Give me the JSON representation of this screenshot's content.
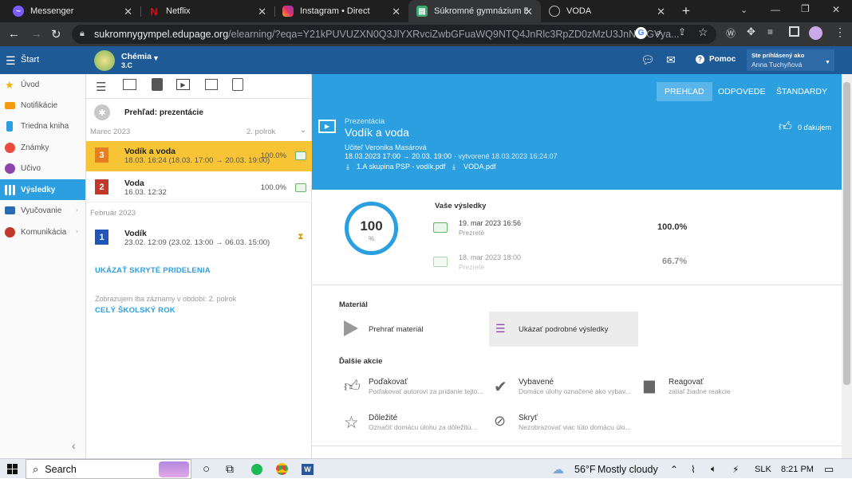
{
  "browser": {
    "tabs": [
      {
        "title": "Messenger",
        "icon": "messenger-icon",
        "color": "#7b5cff"
      },
      {
        "title": "Netflix",
        "icon": "netflix-icon",
        "color": "#e50914"
      },
      {
        "title": "Instagram • Direct",
        "icon": "instagram-icon",
        "color": "#e1306c"
      },
      {
        "title": "Súkromné gymnázium Ba",
        "icon": "edupage-icon",
        "color": "#3aa76d"
      },
      {
        "title": "VODA",
        "icon": "globe-icon",
        "color": "#bbbbbb"
      }
    ],
    "url_host": "sukromnygympel.edupage.org",
    "url_path": "/elearning/?eqa=Y21kPUVUZXN0Q3JlYXRvciZwbGFuaWQ9NTQ4JnRlc3RpZD0zMzU3JnN1cGVya..."
  },
  "topbar": {
    "menu_label": "Štart",
    "class_title": "Chémia",
    "class_sub": "3.C",
    "help_label": "Pomoc",
    "user_caption": "Ste prihlásený ako",
    "user_name": "Anna Tuchyňová"
  },
  "sidebar": {
    "items": [
      {
        "label": "Úvod",
        "icon": "star-icon",
        "color": "#f4b400"
      },
      {
        "label": "Notifikácie",
        "icon": "envelope-icon",
        "color": "#f39c12"
      },
      {
        "label": "Triedna kniha",
        "icon": "book-icon",
        "color": "#2b9fe0"
      },
      {
        "label": "Známky",
        "icon": "grades-icon",
        "color": "#e74c3c"
      },
      {
        "label": "Učivo",
        "icon": "learning-icon",
        "color": "#8e44ad"
      },
      {
        "label": "Výsledky",
        "icon": "results-icon",
        "color": "#ffffff"
      },
      {
        "label": "Vyučovanie",
        "icon": "teaching-icon",
        "color": "#2b6cb0"
      },
      {
        "label": "Komunikácia",
        "icon": "chat-icon",
        "color": "#c0392b"
      }
    ]
  },
  "list": {
    "header": "Prehľad: prezentácie",
    "group1_month": "Marec 2023",
    "group1_term": "2. polrok",
    "group2_month": "Február 2023",
    "rows": [
      {
        "num": "3",
        "title": "Vodík a voda",
        "sub": "18.03. 16:24 (18.03. 17:00 → 20.03. 19:00)",
        "pct": "100.0%",
        "color": "#e67e22"
      },
      {
        "num": "2",
        "title": "Voda",
        "sub": "16.03. 12:32",
        "pct": "100.0%",
        "color": "#c0392b"
      },
      {
        "num": "1",
        "title": "Vodík",
        "sub": "23.02. 12:09 (23.02. 13:00 → 06.03. 15:00)",
        "pct": "",
        "color": "#2255b8"
      }
    ],
    "show_hidden": "UKÁZAŤ SKRYTÉ PRIDELENIA",
    "period_note": "Zobrazujem iba záznamy v období: 2. polrok",
    "whole_year": "CELÝ ŠKOLSKÝ ROK"
  },
  "main": {
    "tabs": [
      "PREHĽAD",
      "ODPOVEDE",
      "ŠTANDARDY"
    ],
    "kind": "Prezentácia",
    "title": "Vodík a voda",
    "teacher": "Učiteľ Veronika Masárová",
    "dates": "18.03.2023 17:00 → 20.03. 19:00",
    "created": "· vytvorené 18.03.2023 16:24:07",
    "file1": "1.A skupina PSP - vodík.pdf",
    "file2": "VODA.pdf",
    "thanks": "0 ďakujem",
    "score": "100",
    "score_unit": "%",
    "score_fraction": 1.0,
    "results_title": "Vaše výsledky",
    "results": [
      {
        "date": "19. mar 2023 16:56",
        "status": "Prezreté",
        "pct": "100.0%"
      },
      {
        "date": "18. mar 2023 18:00",
        "status": "Prezreté",
        "pct": "66.7%"
      }
    ],
    "material_title": "Materiál",
    "play_label": "Prehrať materiál",
    "detail_label": "Ukázať podrobné výsledky",
    "more_title": "Ďalšie akcie",
    "actions": [
      {
        "title": "Poďakovať",
        "desc": "Poďakovať autorovi za pridanie tejto...",
        "icon": "thumbs-up-icon"
      },
      {
        "title": "Vybavené",
        "desc": "Domáce úlohy označené ako vybav...",
        "icon": "check-icon"
      },
      {
        "title": "Reagovať",
        "desc": "zatiaľ žiadne reakcie",
        "icon": "comment-icon"
      },
      {
        "title": "Dôležité",
        "desc": "Označiť domácu úlohu za dôležitú...",
        "icon": "star-outline-icon"
      },
      {
        "title": "Skryť",
        "desc": "Nezobrazovať viac túto domácu úlo...",
        "icon": "eye-off-icon"
      }
    ]
  },
  "taskbar": {
    "search": "Search",
    "temp": "56°F",
    "weather": "Mostly cloudy",
    "lang": "SLK",
    "time": "8:21 PM"
  }
}
